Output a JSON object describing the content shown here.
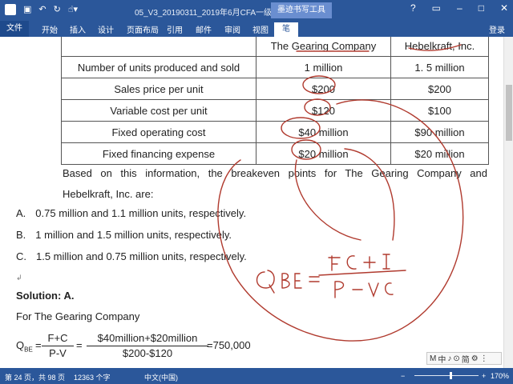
{
  "titlebar": {
    "doc_title": "05_V3_20190311_2019年6月CFA一级百题预...",
    "tool_tab": "墨迹书写工具",
    "logo": "W",
    "qat_icons": [
      "save-icon",
      "undo-icon",
      "redo-icon",
      "touch-mode-icon"
    ],
    "controls": [
      "?",
      "▭",
      "–",
      "□",
      "✕"
    ]
  },
  "ribbon": {
    "tabs": [
      "文件",
      "开始",
      "插入",
      "设计",
      "页面布局",
      "引用",
      "邮件",
      "审阅",
      "视图",
      "笔"
    ],
    "login": "登录"
  },
  "table": {
    "headers": [
      "",
      "The Gearing Company",
      "Hebelkraft, Inc."
    ],
    "rows": [
      [
        "Number of units produced and sold",
        "1 million",
        "1. 5 million"
      ],
      [
        "Sales price per unit",
        "$200",
        "$200"
      ],
      [
        "Variable cost per unit",
        "$120",
        "$100"
      ],
      [
        "Fixed operating cost",
        "$40 million",
        "$90 million"
      ],
      [
        "Fixed financing expense",
        "$20 million",
        "$20 million"
      ]
    ]
  },
  "question": {
    "line1": "Based on this information, the breakeven points for The Gearing Company and",
    "line2": "Hebelkraft, Inc. are:"
  },
  "options": [
    {
      "letter": "A.",
      "text": "0.75 million and 1.1 million units, respectively."
    },
    {
      "letter": "B.",
      "text": "1 million and 1.5 million units, respectively."
    },
    {
      "letter": "C.",
      "text": "1.5 million and 0.75 million units, respectively."
    }
  ],
  "solution": {
    "heading": "Solution: A.",
    "for_line": "For The Gearing Company",
    "q_label": "Q",
    "q_sub": "BE",
    "eq": "=",
    "frac1_num": "F+C",
    "frac1_den": "P-V",
    "frac2_num": "$40million+$20million",
    "frac2_den": "$200-$120",
    "result": "=750,000"
  },
  "ink": {
    "formula": "QBE = FC + I / P - VC",
    "color": "#b03a2e"
  },
  "ime": {
    "items": [
      "M",
      "中",
      "♪",
      "⊙",
      "简",
      "⚙",
      "⋮"
    ]
  },
  "status": {
    "page": "第 24 页，共 98 页",
    "words": "12363 个字",
    "lang": "中文(中国)",
    "zoom_minus": "−",
    "zoom_plus": "+",
    "zoom": "170%",
    "zoom_level": 0.55
  },
  "colors": {
    "accent": "#2b579a",
    "ink": "#b03a2e"
  }
}
